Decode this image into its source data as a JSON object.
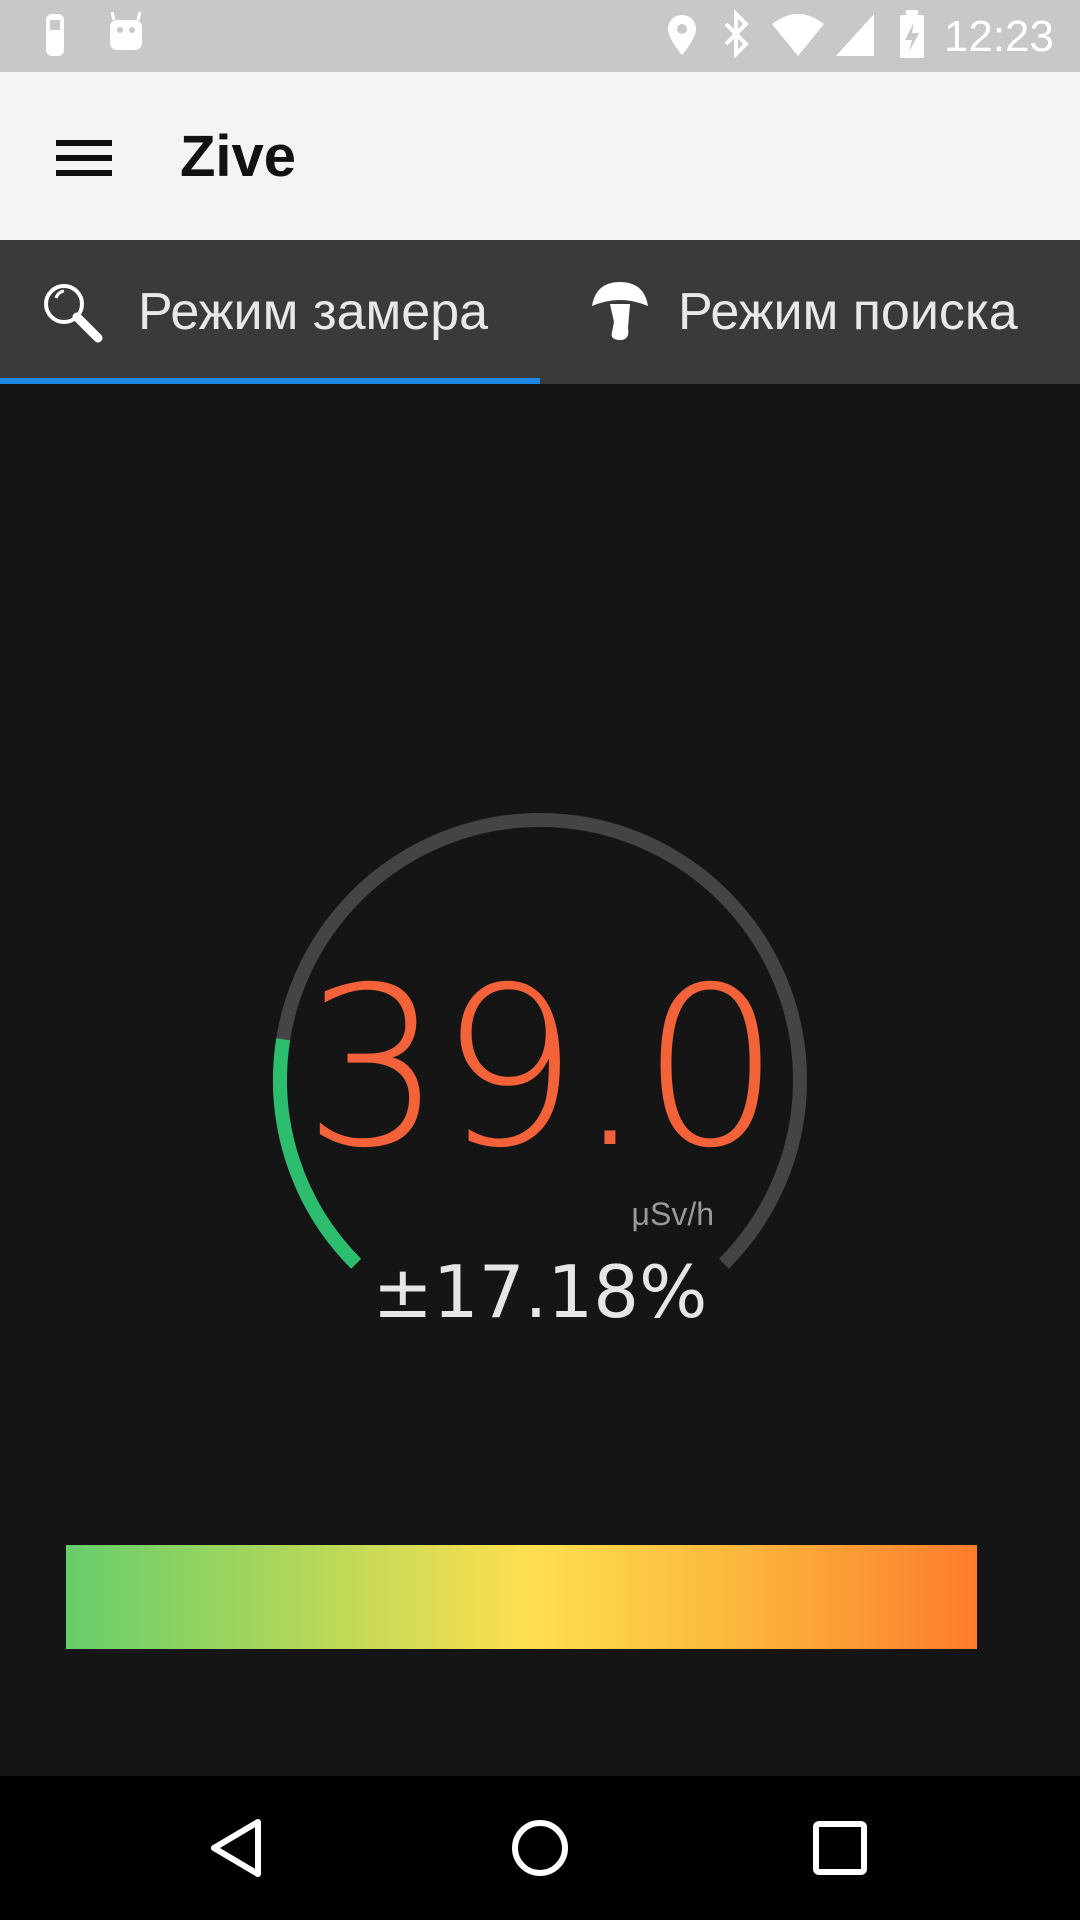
{
  "status_bar": {
    "time": "12:23",
    "icons": [
      "device-icon",
      "android-icon",
      "location-icon",
      "bluetooth-icon",
      "wifi-icon",
      "cell-signal-icon",
      "battery-charging-icon"
    ]
  },
  "app_bar": {
    "title": "Zive",
    "menu_icon": "hamburger-menu-icon"
  },
  "tabs": [
    {
      "label": "Режим замера",
      "icon": "magnifier-icon",
      "selected": true
    },
    {
      "label": "Режим поиска",
      "icon": "mushroom-icon",
      "selected": false
    }
  ],
  "measurement": {
    "value": "39.0",
    "unit": "μSv/h",
    "error": "±17.18%",
    "gauge_fill_fraction": 0.2
  },
  "colors": {
    "value": "#f4623a",
    "gauge_fill": "#2dbd6e",
    "gauge_track": "#444444",
    "tab_indicator": "#1e88e5",
    "scale_start": "#67cd6b",
    "scale_mid": "#ffe050",
    "scale_end": "#fd7c2c"
  },
  "nav_bar": {
    "icons": [
      "back-icon",
      "home-icon",
      "recents-icon"
    ]
  }
}
